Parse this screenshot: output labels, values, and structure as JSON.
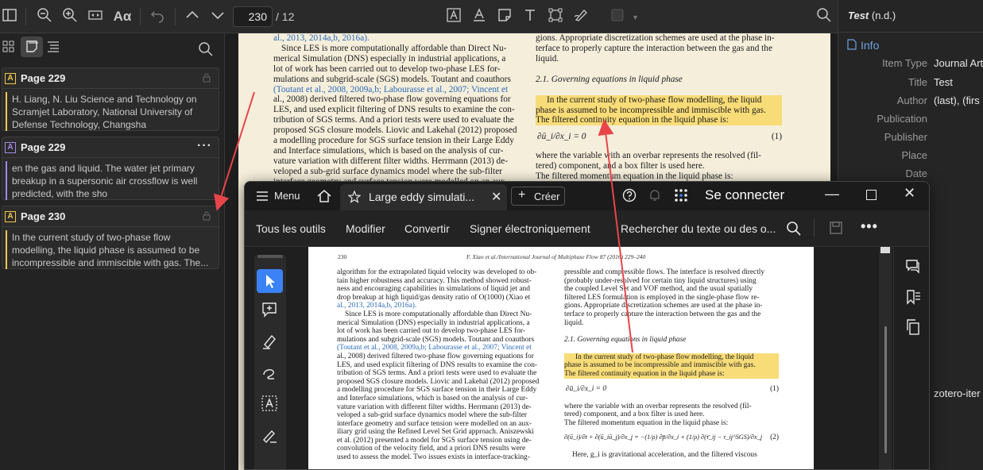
{
  "toolbar": {
    "page_number": "230",
    "page_total": "/ 12",
    "icons": [
      "sidebar-toggle-icon",
      "zoom-out-icon",
      "zoom-in-icon",
      "fit-width-icon",
      "font-icon",
      "undo-icon",
      "prev-page-icon",
      "next-page-icon",
      "highlight-text-icon",
      "underline-text-icon",
      "note-icon",
      "text-icon",
      "area-select-icon",
      "ink-icon",
      "color-icon",
      "search-icon"
    ]
  },
  "sidebar": {
    "annotations": [
      {
        "title": "Page 229",
        "text": "H. Liang, N. Liu Science and Technology on Scramjet Laboratory, National University of Defense Technology, Changsha",
        "color": "#f2c94c"
      },
      {
        "title": "Page 229",
        "text": "en the gas and liquid. The water jet primary breakup in a supersonic air crossflow is well predicted, with the sho",
        "color": "#a28ae5"
      },
      {
        "title": "Page 230",
        "text": "In the current study of two-phase flow modelling, the liquid phase is assumed to be incompressible and immiscible with gas. The...",
        "color": "#f2c94c"
      }
    ],
    "more_label": "···"
  },
  "zpdf": {
    "left_col": [
      {
        "t": "al., 2013, 2014a,b, 2016a).",
        "link": true
      },
      {
        "t": "Since LES is more computationally affordable than Direct Nu-"
      },
      {
        "t": "merical Simulation (DNS) especially in industrial applications, a"
      },
      {
        "t": "lot of work has been carried out to develop two-phase LES for-"
      },
      {
        "t": "mulations and subgrid-scale (SGS) models. Toutant and coauthors"
      },
      {
        "t": "(Toutant et al., 2008, 2009a,b; Labourasse et al., 2007; Vincent et",
        "link": true
      },
      {
        "t": "al., 2008) derived filtered two-phase flow governing equations for"
      },
      {
        "t": "LES, and used explicit filtering of DNS results to examine the con-"
      },
      {
        "t": "tribution of SGS terms. And a priori tests were used to evaluate the"
      },
      {
        "t": "proposed SGS closure models. Liovic and Lakehal (2012) proposed"
      },
      {
        "t": "a modelling procedure for SGS surface tension in their Large Eddy"
      },
      {
        "t": "and Interface simulations, which is based on the analysis of cur-"
      },
      {
        "t": "vature variation with different filter widths. Herrmann (2013) de-"
      },
      {
        "t": "veloped a sub-grid surface dynamics model where the sub-filter"
      },
      {
        "t": "interface geometry and surface tension were modelled on an aux-"
      }
    ],
    "right_col": [
      {
        "t": "gions. Appropriate discretization schemes are used at the phase in-"
      },
      {
        "t": "terface to properly capture the interaction between the gas and the"
      },
      {
        "t": "liquid."
      }
    ],
    "section_title": "2.1. Governing equations in liquid phase",
    "hl_lines": [
      "In the current study of two-phase flow modelling, the liquid",
      "phase is assumed to be incompressible and immiscible with gas.",
      "The filtered continuity equation in the liquid phase is:"
    ],
    "eq1": "∂ū_i/∂x_i = 0",
    "eq1_num": "(1)",
    "after_lines": [
      "where the variable with an overbar represents the resolved (fil-",
      "tered) component, and a box filter is used here.",
      "The filtered momentum equation in the liquid phase is:"
    ]
  },
  "info": {
    "title_italic": "Test",
    "title_suffix": " (n.d.)",
    "section": "Info",
    "rows": [
      {
        "label": "Item Type",
        "value": "Journal Arti"
      },
      {
        "label": "Title",
        "value": "Test"
      },
      {
        "label": "Author",
        "value": "(last), (firs"
      },
      {
        "label": "Publication",
        "value": ""
      },
      {
        "label": "Publisher",
        "value": ""
      },
      {
        "label": "Place",
        "value": ""
      },
      {
        "label": "Date",
        "value": ""
      }
    ],
    "attachment": "zotero-iter"
  },
  "acrobat": {
    "menu_label": "Menu",
    "tab_title": "Large eddy simulati...",
    "create_label": "Créer",
    "signin_label": "Se connecter",
    "tools": [
      "Tous les outils",
      "Modifier",
      "Convertir",
      "Signer électroniquement"
    ],
    "search_placeholder": "Rechercher du texte ou des o...",
    "doc": {
      "page_num": "230",
      "header": "F. Xiao et al./International Journal of Multiphase Flow 87 (2016) 229–240",
      "left_col": [
        {
          "t": "algorithm for the extrapolated liquid velocity was developed to ob-"
        },
        {
          "t": "tain higher robustness and accuracy. This method showed robust-"
        },
        {
          "t": "ness and encouraging capabilities in simulations of liquid jet and"
        },
        {
          "t": "drop breakup at high liquid/gas density ratio of O(1000) (Xiao et"
        },
        {
          "t": "al., 2013, 2014a,b, 2016a).",
          "link": true
        },
        {
          "t": "Since LES is more computationally affordable than Direct Nu-"
        },
        {
          "t": "merical Simulation (DNS) especially in industrial applications, a"
        },
        {
          "t": "lot of work has been carried out to develop two-phase LES for-"
        },
        {
          "t": "mulations and subgrid-scale (SGS) models. Toutant and coauthors"
        },
        {
          "t": "(Toutant et al., 2008, 2009a,b; Labourasse et al., 2007; Vincent et",
          "link": true
        },
        {
          "t": "al., 2008) derived filtered two-phase flow governing equations for"
        },
        {
          "t": "LES, and used explicit filtering of DNS results to examine the con-"
        },
        {
          "t": "tribution of SGS terms. And a priori tests were used to evaluate the"
        },
        {
          "t": "proposed SGS closure models. Liovic and Lakehal (2012) proposed"
        },
        {
          "t": "a modelling procedure for SGS surface tension in their Large Eddy"
        },
        {
          "t": "and Interface simulations, which is based on the analysis of cur-"
        },
        {
          "t": "vature variation with different filter widths. Herrmann (2013) de-"
        },
        {
          "t": "veloped a sub-grid surface dynamics model where the sub-filter"
        },
        {
          "t": "interface geometry and surface tension were modelled on an aux-"
        },
        {
          "t": "iliary grid using the Refined Level Set Grid approach. Aniszewski"
        },
        {
          "t": "et al. (2012) presented a model for SGS surface tension using de-"
        },
        {
          "t": "convolution of the velocity field, and a priori DNS results were"
        },
        {
          "t": "used to assess the model. Two issues exists in interface-tracking-"
        }
      ],
      "right_col": [
        {
          "t": "pressible and compressible flows. The interface is resolved directly"
        },
        {
          "t": "(probably under-resolved for certain tiny liquid structures) using"
        },
        {
          "t": "the coupled Level Set and VOF method, and the usual spatially"
        },
        {
          "t": "filtered LES formulation is employed in the single-phase flow re-"
        },
        {
          "t": "gions. Appropriate discretization schemes are used at the phase in-"
        },
        {
          "t": "terface to properly capture the interaction between the gas and the"
        },
        {
          "t": "liquid."
        }
      ],
      "section_title": "2.1. Governing equations in liquid phase",
      "hl_lines": [
        "In the current study of two-phase flow modelling, the liquid",
        "phase is assumed to be incompressible and immiscible with gas.",
        "The filtered continuity equation in the liquid phase is:"
      ],
      "eq1": "∂ū_i/∂x_i = 0",
      "eq1_num": "(1)",
      "after_lines": [
        "where the variable with an overbar represents the resolved (fil-",
        "tered) component, and a box filter is used here.",
        "The filtered momentum equation in the liquid phase is:"
      ],
      "eq2": "∂(ū_i)/∂t + ∂(ū_iū_j)/∂x_j = −(1/ρ) ∂p̄/∂x_i + (1/ρ) ∂(τ̄_ij − τ_ij^SGS)/∂x_j + g_i + (1/ρ) F̄_i^ST",
      "eq2_num": "(2)",
      "last_line": "Here, g_i is gravitational acceleration, and the filtered viscous"
    }
  },
  "colors": {
    "highlight": "#f8dc78",
    "arrow": "#e8454a",
    "link": "#2a6ab8",
    "accent_blue": "#3b82f6"
  }
}
